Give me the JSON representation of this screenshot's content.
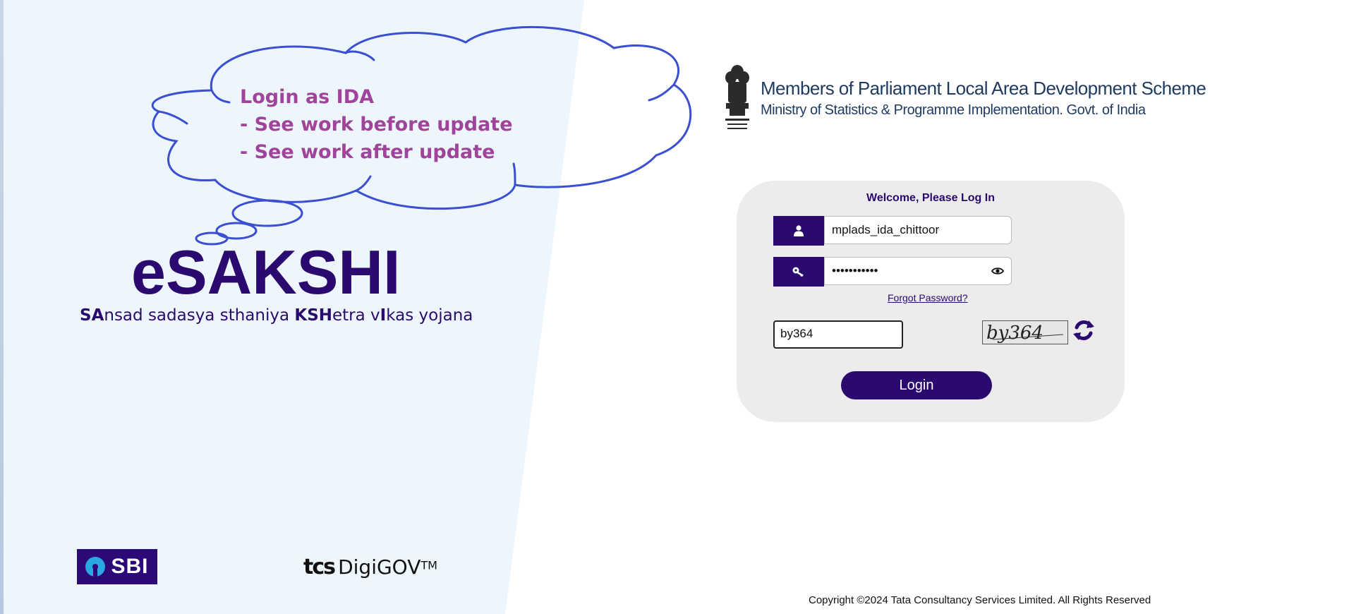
{
  "cloud": {
    "line1": "Login as IDA",
    "line2": "- See work before update",
    "line3": "- See work after update"
  },
  "brand": {
    "title": "eSAKSHI",
    "sub_sa": "SA",
    "sub_1": "nsad sadasya sthaniya ",
    "sub_ksh": "KSH",
    "sub_2": "etra v",
    "sub_i": "I",
    "sub_3": "kas yojana"
  },
  "header": {
    "line1": "Members of Parliament Local Area Development Scheme",
    "line2": "Ministry of Statistics & Programme Implementation. Govt. of India"
  },
  "login": {
    "welcome": "Welcome, Please Log In",
    "username_value": "mplads_ida_chittoor",
    "password_value": "•••••••••••",
    "forgot": "Forgot Password?",
    "captcha_input_value": "by364",
    "captcha_image_text": "by364",
    "button_label": "Login"
  },
  "footer": {
    "sbi": "SBI",
    "tcs_left": "tcs",
    "tcs_right": "DigiGOV",
    "tm": "TM",
    "copyright": "Copyright ©2024 Tata Consultancy Services Limited. All Rights Reserved"
  },
  "colors": {
    "brand": "#2a0a6e",
    "cloud_stroke": "#3a4fd1",
    "cloud_text": "#a0449b",
    "left_bg": "#eef6fd"
  },
  "icons": {
    "user": "user-icon",
    "key": "key-icon",
    "eye": "eye-icon",
    "refresh": "refresh-icon",
    "emblem": "national-emblem-icon"
  }
}
